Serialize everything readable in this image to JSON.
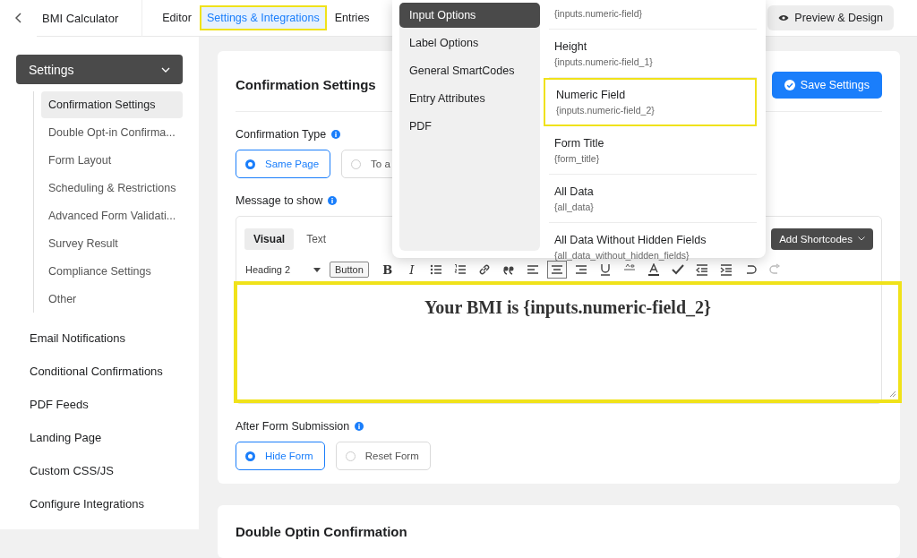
{
  "topbar": {
    "form_name": "BMI Calculator",
    "tabs": [
      {
        "label": "Editor",
        "selected": false,
        "highlighted": false
      },
      {
        "label": "Settings & Integrations",
        "selected": true,
        "highlighted": true
      },
      {
        "label": "Entries",
        "selected": false,
        "highlighted": false
      }
    ],
    "preview_button": "Preview & Design"
  },
  "sidebar": {
    "settings_menu": {
      "label": "Settings",
      "expanded": true,
      "children": [
        {
          "label": "Confirmation Settings",
          "selected": true
        },
        {
          "label": "Double Opt-in Confirma...",
          "selected": false
        },
        {
          "label": "Form Layout",
          "selected": false
        },
        {
          "label": "Scheduling & Restrictions",
          "selected": false
        },
        {
          "label": "Advanced Form Validati...",
          "selected": false
        },
        {
          "label": "Survey Result",
          "selected": false
        },
        {
          "label": "Compliance Settings",
          "selected": false
        },
        {
          "label": "Other",
          "selected": false
        }
      ]
    },
    "items": [
      {
        "label": "Email Notifications"
      },
      {
        "label": "Conditional Confirmations"
      },
      {
        "label": "PDF Feeds"
      },
      {
        "label": "Landing Page"
      },
      {
        "label": "Custom CSS/JS"
      },
      {
        "label": "Configure Integrations"
      }
    ]
  },
  "confirmation_card": {
    "title": "Confirmation Settings",
    "save_button": "Save Settings",
    "confirmation_type": {
      "label": "Confirmation Type",
      "options": [
        {
          "label": "Same Page",
          "selected": true
        },
        {
          "label": "To a",
          "selected": false
        }
      ]
    },
    "message": {
      "label": "Message to show",
      "editor_tabs": [
        {
          "label": "Visual",
          "selected": true
        },
        {
          "label": "Text",
          "selected": false
        }
      ],
      "add_shortcodes": "Add Shortcodes",
      "format": "Heading 2",
      "button_label": "Button",
      "tools": [
        {
          "kind": "text",
          "label": "B",
          "pressed": false
        },
        {
          "kind": "italic",
          "label": "I",
          "pressed": false
        },
        {
          "kind": "bullets",
          "pressed": false
        },
        {
          "kind": "numbers",
          "pressed": false
        },
        {
          "kind": "link",
          "pressed": false
        },
        {
          "kind": "quote",
          "pressed": false
        },
        {
          "kind": "align-left",
          "pressed": false
        },
        {
          "kind": "align-center",
          "pressed": true
        },
        {
          "kind": "align-right",
          "pressed": false
        },
        {
          "kind": "underline",
          "pressed": false
        },
        {
          "kind": "strike",
          "pressed": false
        },
        {
          "kind": "color",
          "pressed": false
        },
        {
          "kind": "check",
          "pressed": false
        },
        {
          "kind": "outdent",
          "pressed": false
        },
        {
          "kind": "indent",
          "pressed": false
        },
        {
          "kind": "undo",
          "pressed": false
        },
        {
          "kind": "redo",
          "pressed": false
        }
      ],
      "content": "Your BMI is {inputs.numeric-field_2}",
      "highlighted": true
    },
    "after_submission": {
      "label": "After Form Submission",
      "options": [
        {
          "label": "Hide Form",
          "selected": true
        },
        {
          "label": "Reset Form",
          "selected": false
        }
      ]
    }
  },
  "second_card": {
    "title": "Double Optin Confirmation"
  },
  "shortcode_popup": {
    "groups": [
      {
        "label": "Input Options",
        "selected": true
      },
      {
        "label": "Label Options",
        "selected": false
      },
      {
        "label": "General SmartCodes",
        "selected": false
      },
      {
        "label": "Entry Attributes",
        "selected": false
      },
      {
        "label": "PDF",
        "selected": false
      }
    ],
    "codes": [
      {
        "code": "{inputs.numeric-field}",
        "highlighted": false
      },
      {
        "title": "Height",
        "code": "{inputs.numeric-field_1}",
        "highlighted": false
      },
      {
        "title": "Numeric Field",
        "code": "{inputs.numeric-field_2}",
        "highlighted": true
      },
      {
        "title": "Form Title",
        "code": "{form_title}",
        "highlighted": false
      },
      {
        "title": "All Data",
        "code": "{all_data}",
        "highlighted": false
      },
      {
        "title": "All Data Without Hidden Fields",
        "code": "{all_data_without_hidden_fields}",
        "highlighted": false
      }
    ]
  }
}
